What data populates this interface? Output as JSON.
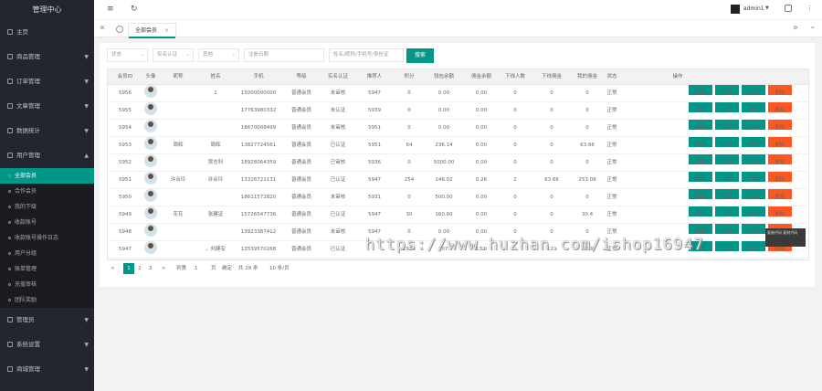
{
  "app_title": "管理中心",
  "sidebar": {
    "items": [
      {
        "label": "主页",
        "arrow": ""
      },
      {
        "label": "商品管理",
        "arrow": "▼"
      },
      {
        "label": "订单管理",
        "arrow": "▼"
      },
      {
        "label": "文章管理",
        "arrow": "▼"
      },
      {
        "label": "数据统计",
        "arrow": "▼"
      },
      {
        "label": "用户管理",
        "arrow": "▲"
      }
    ],
    "sub_items": [
      "全部会员",
      "合作会员",
      "我的下级",
      "收款账号",
      "收款账号操作日志",
      "用户分组",
      "账单管理",
      "充值审核",
      "团队奖励"
    ],
    "bottom_items": [
      {
        "label": "管理员",
        "arrow": "▼"
      },
      {
        "label": "系统设置",
        "arrow": "▼"
      },
      {
        "label": "商城管理",
        "arrow": "▼"
      }
    ]
  },
  "topbar": {
    "menu_icon": "≡",
    "refresh_icon": "↻",
    "user": "admin1",
    "user_arrow": "▼"
  },
  "tabs": {
    "active": "全部会员",
    "close": "×",
    "left_arrow": "«",
    "right_arrow": "»",
    "more": "⌄"
  },
  "filters": {
    "status": "状态",
    "realname": "实名认证",
    "other": "其他",
    "date_placeholder": "注册日期",
    "keyword_placeholder": "姓名/昵称/手机号/身份证",
    "search": "搜索"
  },
  "table": {
    "headers": [
      "会员ID",
      "头像",
      "昵称",
      "姓名",
      "手机",
      "等级",
      "实名认证",
      "推荐人",
      "积分",
      "钱包余额",
      "佣金余额",
      "下线人数",
      "下线佣金",
      "我的佣金",
      "状态",
      "操作"
    ],
    "rows": [
      {
        "id": "5956",
        "nick": "",
        "name": "1",
        "phone": "15000000000",
        "level": "普通会员",
        "auth": "未审核",
        "ref": "5947",
        "points": "0",
        "wallet": "0.00",
        "comm": "0.00",
        "down": "0",
        "down_comm": "0",
        "my_comm": "0",
        "status": "正常"
      },
      {
        "id": "5955",
        "nick": "",
        "name": "",
        "phone": "17763980332",
        "level": "普通会员",
        "auth": "未认证",
        "ref": "5939",
        "points": "0",
        "wallet": "0.00",
        "comm": "0.00",
        "down": "0",
        "down_comm": "0",
        "my_comm": "0",
        "status": "正常"
      },
      {
        "id": "5954",
        "nick": "",
        "name": "",
        "phone": "18670008499",
        "level": "普通会员",
        "auth": "未审核",
        "ref": "5951",
        "points": "0",
        "wallet": "0.00",
        "comm": "0.00",
        "down": "0",
        "down_comm": "0",
        "my_comm": "0",
        "status": "正常"
      },
      {
        "id": "5953",
        "nick": "周辉",
        "name": "周辉",
        "phone": "13827724561",
        "level": "普通会员",
        "auth": "已认证",
        "ref": "5951",
        "points": "64",
        "wallet": "236.14",
        "comm": "0.00",
        "down": "0",
        "down_comm": "0",
        "my_comm": "63.66",
        "status": "正常"
      },
      {
        "id": "5952",
        "nick": "",
        "name": "贾志科",
        "phone": "18928064359",
        "level": "普通会员",
        "auth": "已审核",
        "ref": "5936",
        "points": "0",
        "wallet": "5000.00",
        "comm": "0.00",
        "down": "0",
        "down_comm": "0",
        "my_comm": "0",
        "status": "正常"
      },
      {
        "id": "5951",
        "nick": "许合玲",
        "name": "许合玲",
        "phone": "13326721131",
        "level": "普通会员",
        "auth": "已认证",
        "ref": "5947",
        "points": "254",
        "wallet": "146.02",
        "comm": "0.26",
        "down": "2",
        "down_comm": "63.66",
        "my_comm": "253.08",
        "status": "正常"
      },
      {
        "id": "5950",
        "nick": "",
        "name": "",
        "phone": "18611572820",
        "level": "普通会员",
        "auth": "未审核",
        "ref": "5931",
        "points": "0",
        "wallet": "500.00",
        "comm": "0.00",
        "down": "0",
        "down_comm": "0",
        "my_comm": "0",
        "status": "正常"
      },
      {
        "id": "5949",
        "nick": "花花",
        "name": "张建证",
        "phone": "15726547736",
        "level": "普通会员",
        "auth": "已认证",
        "ref": "5947",
        "points": "30",
        "wallet": "160.60",
        "comm": "0.00",
        "down": "0",
        "down_comm": "0",
        "my_comm": "30.4",
        "status": "正常"
      },
      {
        "id": "5948",
        "nick": "",
        "name": "",
        "phone": "13923387412",
        "level": "普通会员",
        "auth": "未审核",
        "ref": "5947",
        "points": "0",
        "wallet": "0.00",
        "comm": "0.00",
        "down": "0",
        "down_comm": "0",
        "my_comm": "0",
        "status": "正常"
      },
      {
        "id": "5947",
        "nick": "",
        "name": "。刘建宏",
        "phone": "13539570268",
        "level": "普通会员",
        "auth": "已认证",
        "ref": "",
        "points": "1934",
        "wallet": "107.",
        "comm": "13.0",
        "down": "",
        "down_comm": "124",
        "my_comm": "1899",
        "status": "正常"
      }
    ],
    "actions": {
      "edit": "编辑",
      "down": "下级",
      "more": "关联",
      "del": "删除"
    }
  },
  "pager": {
    "prev": "<",
    "pages": [
      "1",
      "2",
      "3"
    ],
    "next": ">",
    "goto": "到第",
    "page_val": "1",
    "page_unit": "页",
    "confirm": "确定",
    "total": "共 29 条",
    "per_page": "10 条/页"
  },
  "watermark": "https://www.huzhan.com/ishop16947",
  "tooltip": "复制代码 复制代码"
}
